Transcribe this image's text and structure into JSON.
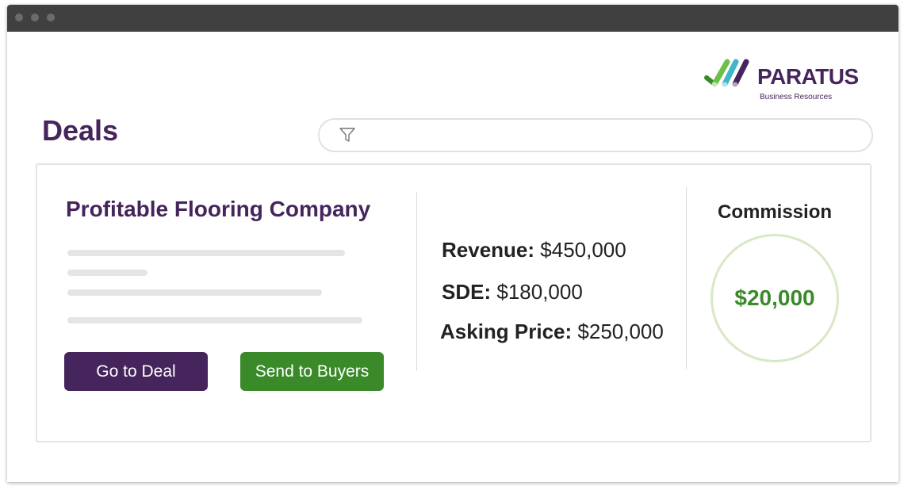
{
  "brand": {
    "name": "PARATUS",
    "tagline": "Business Resources",
    "colors": {
      "primary": "#45255b",
      "accent_green": "#3a8a2a",
      "accent_teal": "#3fb6c9"
    },
    "icon": "check-stripes-logo-icon"
  },
  "page": {
    "title": "Deals"
  },
  "search": {
    "icon": "filter-icon",
    "value": "",
    "placeholder": ""
  },
  "deal": {
    "title": "Profitable Flooring Company",
    "stats": [
      {
        "label": "Revenue:",
        "value": "$450,000"
      },
      {
        "label": "SDE:",
        "value": "$180,000"
      },
      {
        "label": "Asking Price:",
        "value": "$250,000"
      }
    ],
    "commission": {
      "label": "Commission",
      "value": "$20,000"
    },
    "buttons": {
      "go_to_deal": "Go to Deal",
      "send_to_buyers": "Send to Buyers"
    }
  }
}
